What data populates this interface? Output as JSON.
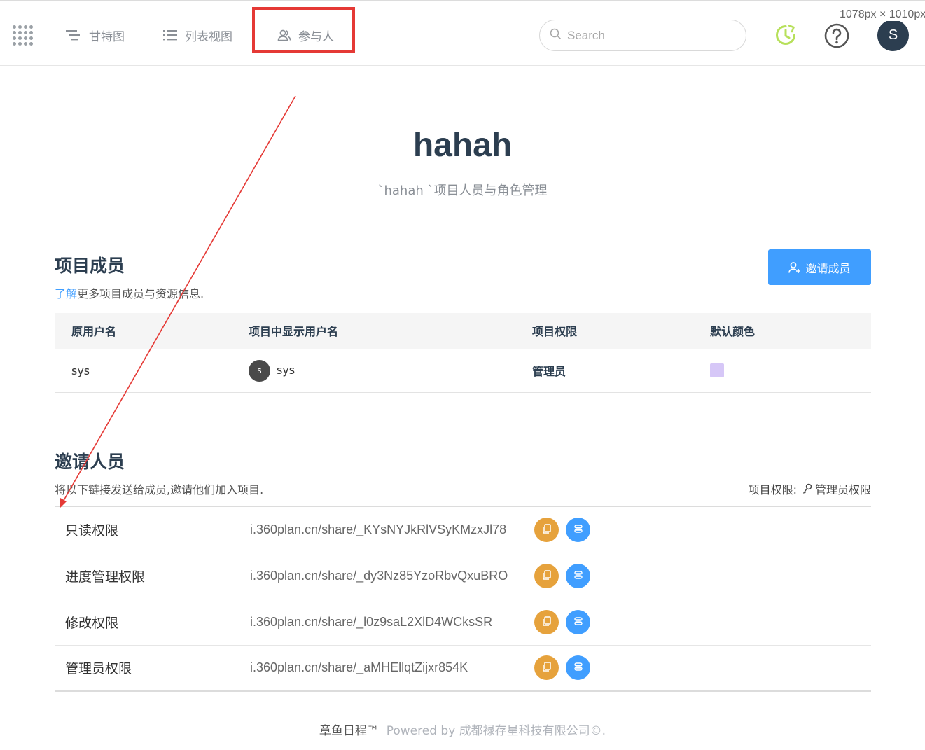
{
  "header": {
    "nav": [
      {
        "label": "甘特图",
        "icon": "gantt-icon"
      },
      {
        "label": "列表视图",
        "icon": "list-icon"
      },
      {
        "label": "参与人",
        "icon": "users-icon"
      }
    ],
    "search_placeholder": "Search",
    "avatar_letter": "S",
    "viewport_overlay": "1078px × 1010px"
  },
  "project": {
    "title": "hahah",
    "subtitle": "`hahah `项目人员与角色管理"
  },
  "members": {
    "title": "项目成员",
    "learn_link": "了解",
    "desc_rest": "更多项目成员与资源信息.",
    "invite_button": "邀请成员",
    "columns": [
      "原用户名",
      "项目中显示用户名",
      "项目权限",
      "默认颜色"
    ],
    "rows": [
      {
        "username": "sys",
        "avatar_letter": "s",
        "display_name": "sys",
        "role": "管理员",
        "color": "#d6c7f7"
      }
    ]
  },
  "invite": {
    "title": "邀请人员",
    "desc": "将以下链接发送给成员,邀请他们加入项目.",
    "permission_label": "项目权限:",
    "permission_value": "管理员权限",
    "links": [
      {
        "name": "只读权限",
        "url": "i.360plan.cn/share/_KYsNYJkRlVSyKMzxJl78"
      },
      {
        "name": "进度管理权限",
        "url": "i.360plan.cn/share/_dy3Nz85YzoRbvQxuBRO"
      },
      {
        "name": "修改权限",
        "url": "i.360plan.cn/share/_l0z9saL2XlD4WCksSR"
      },
      {
        "name": "管理员权限",
        "url": "i.360plan.cn/share/_aMHEllqtZijxr854K"
      }
    ]
  },
  "footer": {
    "brand": "章鱼日程™",
    "powered": "Powered by 成都禄存星科技有限公司©."
  },
  "colors": {
    "primary": "#409eff",
    "warning": "#e6a23c",
    "title": "#2c3e50",
    "highlight": "#e53935",
    "clock": "#b7e05a"
  }
}
